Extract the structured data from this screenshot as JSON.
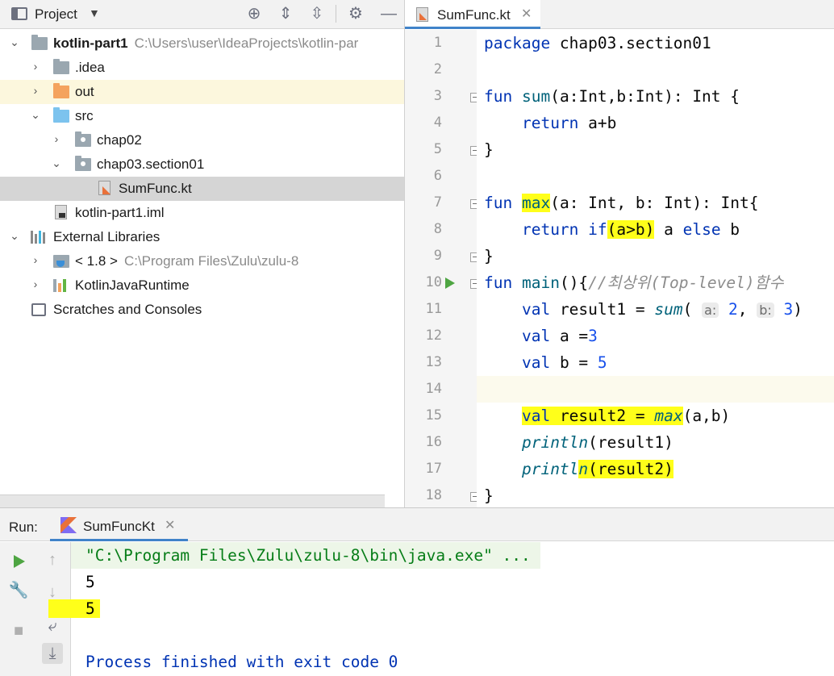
{
  "project_panel": {
    "title": "Project",
    "tree": [
      {
        "label": "kotlin-part1",
        "path": "C:\\Users\\user\\IdeaProjects\\kotlin-par"
      },
      {
        "label": ".idea"
      },
      {
        "label": "out"
      },
      {
        "label": "src"
      },
      {
        "label": "chap02"
      },
      {
        "label": "chap03.section01"
      },
      {
        "label": "SumFunc.kt"
      },
      {
        "label": "kotlin-part1.iml"
      },
      {
        "label": "External Libraries"
      },
      {
        "label": "< 1.8 >",
        "path": "C:\\Program Files\\Zulu\\zulu-8"
      },
      {
        "label": "KotlinJavaRuntime"
      },
      {
        "label": "Scratches and Consoles"
      }
    ]
  },
  "editor": {
    "tab_label": "SumFunc.kt",
    "line_numbers": [
      "1",
      "2",
      "3",
      "4",
      "5",
      "6",
      "7",
      "8",
      "9",
      "10",
      "11",
      "12",
      "13",
      "14",
      "15",
      "16",
      "17",
      "18"
    ],
    "code": {
      "l1_kw": "package",
      "l1_rest": " chap03.section01",
      "l3_kw": "fun",
      "l3_fn": "sum",
      "l3_rest": "(a:Int,b:Int): Int {",
      "l4_kw": "return",
      "l4_rest": " a+b",
      "l5": "}",
      "l7_kw": "fun",
      "l7_fn": "max",
      "l7_rest": "(a: Int, b: Int): Int{",
      "l8_kw": "return",
      "l8_if": "if",
      "l8_cond": "(a>b)",
      "l8_a": " a ",
      "l8_else": "else",
      "l8_b": " b",
      "l9": "}",
      "l10_kw": "fun",
      "l10_fn": "main",
      "l10_rest": "(){",
      "l10_comment": "//최상위(Top-level)함수",
      "l11_kw": "val",
      "l11_rest": " result1 = ",
      "l11_fn": "sum",
      "l11_paren": "( ",
      "l11_hint_a": "a:",
      "l11_num_a": " 2",
      "l11_comma": ", ",
      "l11_hint_b": "b:",
      "l11_num_b": " 3",
      "l11_close": ")",
      "l12_kw": "val",
      "l12_rest": " a =",
      "l12_num": "3",
      "l13_kw": "val",
      "l13_rest": " b = ",
      "l13_num": "5",
      "l15_kw": "val",
      "l15_rest": " result2 = ",
      "l15_fn": "max",
      "l15_args": "(a,b)",
      "l16_fn": "println",
      "l16_args": "(result1)",
      "l17_fn_a": "printl",
      "l17_fn_b": "n",
      "l17_args": "(result2)",
      "l18": "}"
    }
  },
  "run_panel": {
    "label": "Run:",
    "tab_label": "SumFuncKt",
    "output": [
      "\"C:\\Program Files\\Zulu\\zulu-8\\bin\\java.exe\" ...",
      "5",
      "5",
      "",
      "Process finished with exit code 0"
    ]
  },
  "colors": {
    "accent": "#4083c9",
    "highlight": "#ffff1a",
    "keyword": "#0033b3",
    "function": "#00627a",
    "number": "#1750eb",
    "run_green": "#4ea542"
  }
}
